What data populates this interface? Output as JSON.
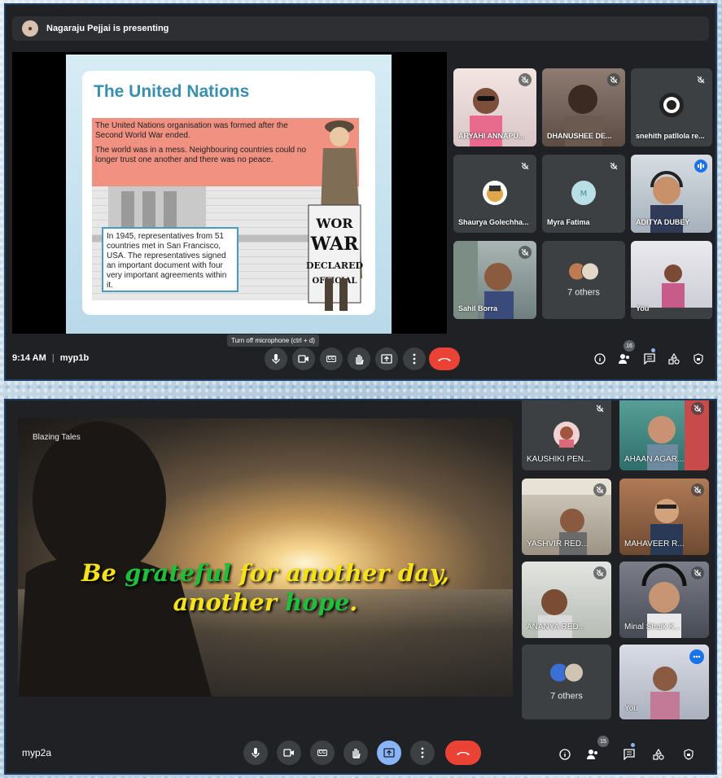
{
  "meet1": {
    "presenter_banner": "Nagaraju Pejjai is presenting",
    "slide": {
      "title": "The United Nations",
      "para1": "The United Nations organisation was formed after the Second World War ended.",
      "para2": "The world was in a mess. Neighbouring countries could no longer trust one another and there was no peace.",
      "note": "In 1945, representatives from 51 countries met in San Francisco, USA. The representatives signed an important document with four very important agreements within it.",
      "newspaper": "WORLD WAR DECLARED OFFICIAL"
    },
    "participants": [
      {
        "name": "ARYAHI ANNAPU...",
        "muted": true
      },
      {
        "name": "DHANUSHEE DE...",
        "muted": true
      },
      {
        "name": "snehith patllola re...",
        "muted": true
      },
      {
        "name": "Shaurya Golechha...",
        "muted": true
      },
      {
        "name": "Myra Fatima",
        "muted": true
      },
      {
        "name": "ADITYA DUBEY",
        "muted": false,
        "speaking": true
      },
      {
        "name": "Sahil Borra",
        "muted": true
      },
      {
        "name": "7 others"
      },
      {
        "name": "You"
      }
    ],
    "time": "9:14 AM",
    "separator": "|",
    "meeting_code": "myp1b",
    "tooltip": "Turn off microphone (ctrl + d)",
    "people_count": "16",
    "cc_label": "CC"
  },
  "meet2": {
    "stage_label": "Blazing Tales",
    "quote": {
      "w1": "Be ",
      "w2": "grateful ",
      "w3": "for another day,",
      "w4": "another ",
      "w5": "hope",
      "w6": "."
    },
    "participants": [
      {
        "name": "KAUSHIKI PEN...",
        "muted": true
      },
      {
        "name": "AHAAN AGAR...",
        "muted": true
      },
      {
        "name": "YASHVIR RED...",
        "muted": true
      },
      {
        "name": "MAHAVEER R...",
        "muted": true
      },
      {
        "name": "ANANYA RED...",
        "muted": true
      },
      {
        "name": "Minal Shaik K...",
        "muted": true
      },
      {
        "name": "7 others"
      },
      {
        "name": "You"
      }
    ],
    "meeting_code": "myp2a",
    "people_count": "15",
    "cc_label": "CC"
  },
  "colors": {
    "end_call": "#ea4335",
    "accent": "#8ab4f8",
    "tile": "#3c4043",
    "background": "#202124"
  }
}
